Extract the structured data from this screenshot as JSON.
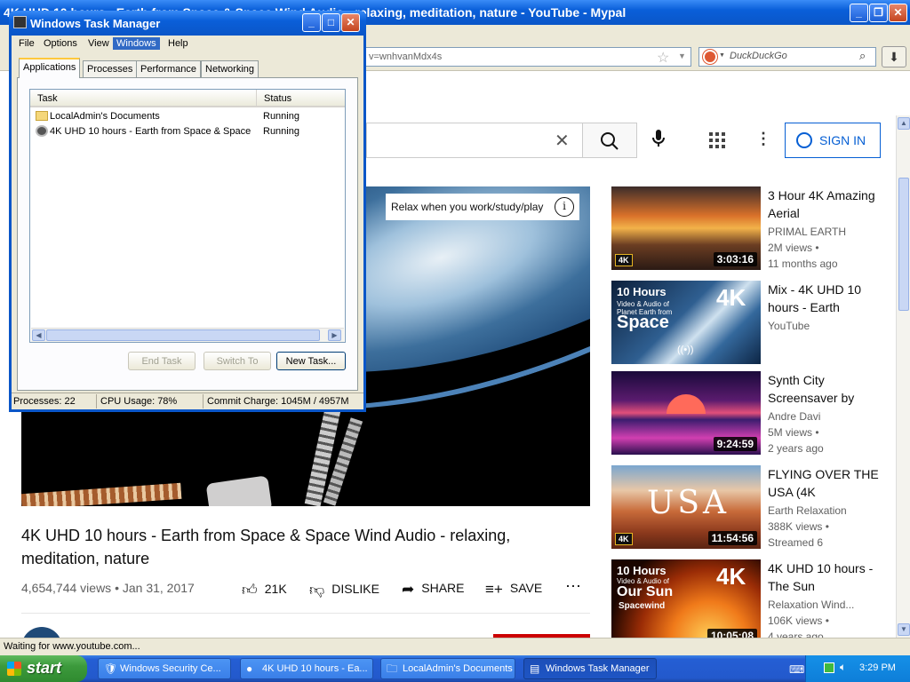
{
  "browser": {
    "title": "4K UHD 10 hours - Earth from Space & Space Wind Audio - relaxing, meditation, nature - YouTube - Mypal",
    "url_fragment": "v=wnhvanMdx4s",
    "search_placeholder": "DuckDuckGo",
    "status_text": "Waiting for www.youtube.com..."
  },
  "youtube": {
    "signin_label": "SIGN IN",
    "player_overlay": "Relax when you work/study/play",
    "video_title": "4K UHD 10 hours - Earth from Space & Space Wind Audio - relaxing, meditation, nature",
    "video_meta": "4,654,744 views • Jan 31, 2017",
    "actions": {
      "likes": "21K",
      "dislike": "DISLIKE",
      "share": "SHARE",
      "save": "SAVE"
    },
    "recommendations": [
      {
        "title": "3 Hour 4K Amazing Aerial",
        "channel": "PRIMAL EARTH",
        "views": "2M views •",
        "age": "11 months ago",
        "duration": "3:03:16",
        "badge": "4K"
      },
      {
        "title": "Mix - 4K UHD 10 hours - Earth",
        "channel": "YouTube",
        "views": "",
        "age": "",
        "duration": "",
        "thumb_text_1": "10 Hours",
        "thumb_text_2": "Video & Audio of Planet Earth from",
        "thumb_text_3": "Space",
        "thumb_badge": "4K"
      },
      {
        "title": "Synth City Screensaver by",
        "channel": "Andre Davi",
        "views": "5M views •",
        "age": "2 years ago",
        "duration": "9:24:59"
      },
      {
        "title": "FLYING OVER THE USA (4K",
        "channel": "Earth Relaxation",
        "views": "388K views •",
        "age": "Streamed 6",
        "duration": "11:54:56",
        "thumb_text_1": "USA",
        "badge": "4K"
      },
      {
        "title": "4K UHD 10 hours - The Sun",
        "channel": "Relaxation Wind...",
        "views": "106K views •",
        "age": "4 years ago",
        "duration": "10:05:08",
        "thumb_text_1": "10 Hours",
        "thumb_text_2": "Video & Audio of",
        "thumb_text_3": "Our Sun",
        "thumb_text_4": "Spacewind",
        "thumb_badge": "4K"
      }
    ]
  },
  "taskmanager": {
    "title": "Windows Task Manager",
    "menu": [
      "File",
      "Options",
      "View",
      "Windows",
      "Help"
    ],
    "tabs": [
      "Applications",
      "Processes",
      "Performance",
      "Networking"
    ],
    "columns": [
      "Task",
      "Status"
    ],
    "tasks": [
      {
        "name": "LocalAdmin's Documents",
        "status": "Running"
      },
      {
        "name": "4K UHD 10 hours - Earth from Space & Space ...",
        "status": "Running"
      }
    ],
    "buttons": {
      "end_task": "End Task",
      "switch_to": "Switch To",
      "new_task": "New Task..."
    },
    "status": {
      "processes": "Processes: 22",
      "cpu": "CPU Usage: 78%",
      "commit": "Commit Charge: 1045M / 4957M"
    }
  },
  "taskbar": {
    "start_label": "start",
    "items": [
      {
        "label": "Windows Security Ce..."
      },
      {
        "label": "4K UHD 10 hours - Ea..."
      },
      {
        "label": "LocalAdmin's Documents"
      },
      {
        "label": "Windows Task Manager"
      }
    ],
    "clock": "3:29 PM"
  }
}
